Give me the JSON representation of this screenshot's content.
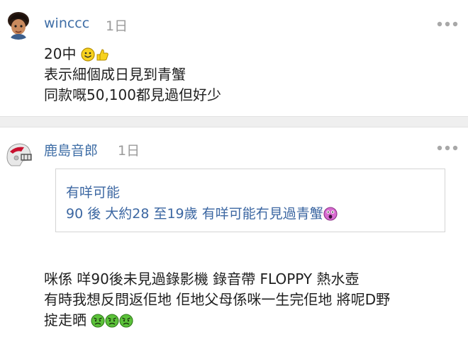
{
  "posts": [
    {
      "username": "winccc",
      "timestamp": "1日",
      "lines": [
        "20中",
        "表示細個成日見到青蟹",
        "同款嘅50,100都見過但好少"
      ],
      "icons": [
        "smiley-icon",
        "thumbs-up-icon"
      ]
    },
    {
      "username": "鹿島音郎",
      "timestamp": "1日",
      "quote": {
        "lines": [
          "有咩可能",
          "90 後 大約28 至19歲 有咩可能冇見過青蟹"
        ],
        "icons": [
          "shocked-face-icon"
        ]
      },
      "lines": [
        "咪係 咩90後未見過錄影機 錄音帶 FLOPPY 熱水壺",
        "有時我想反問返佢地 佢地父母係咪一生完佢地 將呢D野",
        "掟走晒"
      ],
      "icons": [
        "angry-face-icon",
        "angry-face-icon",
        "angry-face-icon"
      ]
    }
  ],
  "colors": {
    "username": "#3f6ea6",
    "quote_text": "#3c67a2",
    "timestamp": "#9a9a9a",
    "body_text": "#1f1f1f",
    "separator": "#efefef"
  }
}
